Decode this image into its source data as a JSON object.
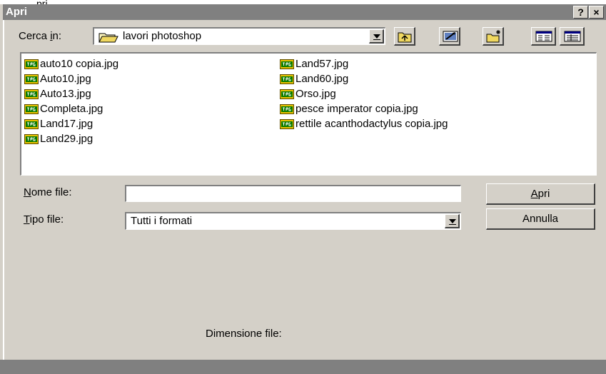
{
  "top_fragment": "pri",
  "window": {
    "title": "Apri",
    "help_label": "?",
    "close_label": "×"
  },
  "look_in": {
    "label_prefix": "Cerca ",
    "label_accel": "i",
    "label_suffix": "n:",
    "folder_icon": "folder-icon",
    "value": "lavori photoshop"
  },
  "toolbar_icons": [
    "up-folder-icon",
    "desktop-icon",
    "new-folder-icon",
    "list-view-icon",
    "details-view-icon"
  ],
  "files": {
    "icon": "jpg-file-icon",
    "column1": [
      "auto10 copia.jpg",
      "Auto10.jpg",
      "Auto13.jpg",
      "Completa.jpg",
      "Land17.jpg",
      "Land29.jpg"
    ],
    "column2": [
      "Land57.jpg",
      "Land60.jpg",
      "Orso.jpg",
      "pesce imperator copia.jpg",
      "rettile acanthodactylus copia.jpg"
    ]
  },
  "file_name": {
    "label_accel": "N",
    "label_rest": "ome file:",
    "value": ""
  },
  "file_type": {
    "label_accel": "T",
    "label_rest": "ipo file:",
    "value": "Tutti i formati"
  },
  "buttons": {
    "open_accel": "A",
    "open_rest": "pri",
    "cancel": "Annulla"
  },
  "file_size_label": "Dimensione file:",
  "colors": {
    "face": "#d4d0c8",
    "titlebar": "#808080",
    "icon_yellow": "#e8c000",
    "icon_green": "#0a7a00"
  }
}
